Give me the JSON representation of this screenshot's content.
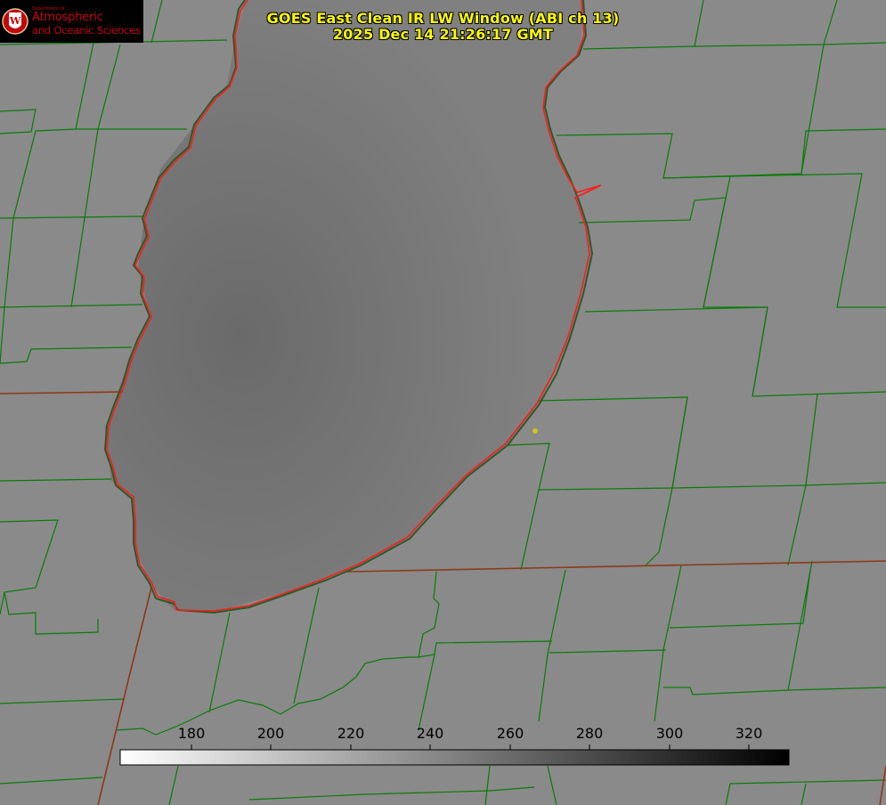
{
  "logo": {
    "line1": "Department of",
    "line2": "Atmospheric",
    "line3": "and Oceanic Sciences",
    "seal_letter": "W",
    "color": "#c5050c"
  },
  "title": {
    "line1": "GOES East Clean IR LW Window (ABI ch 13)",
    "line2": "2025 Dec 14 21:26:17 GMT",
    "color": "#ffff00"
  },
  "colorbar": {
    "min": 163,
    "max": 330,
    "ticks": [
      "180",
      "200",
      "220",
      "240",
      "260",
      "280",
      "300",
      "320"
    ],
    "gradient": "white-to-black",
    "units_hint": "brightness temperature"
  },
  "map": {
    "background_gray": "#8a8a8a",
    "lake_gray": "#7a7a7a",
    "county_line_color": "#0a7a0a",
    "state_line_color": "#8b3a1a",
    "coastline_color": "#ff1a1a",
    "marker_color": "#d4c21a"
  }
}
